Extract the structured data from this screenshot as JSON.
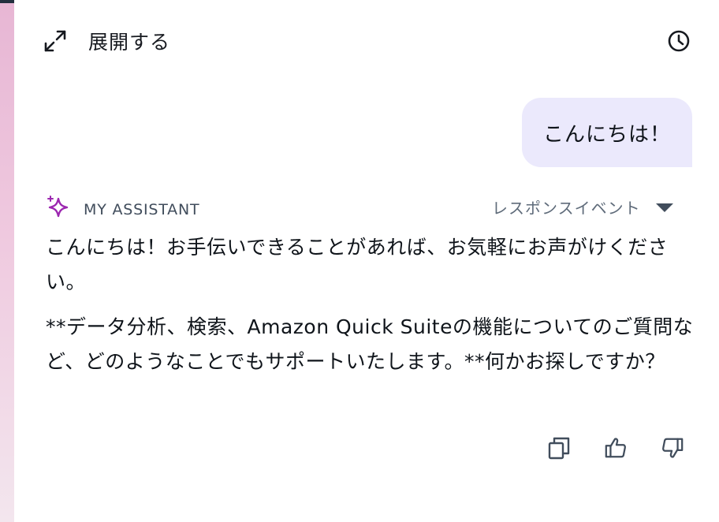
{
  "header": {
    "expand_label": "展開する",
    "expand_icon": "expand-arrows-icon",
    "history_icon": "clock-icon"
  },
  "conversation": {
    "user_message": "こんにちは！",
    "assistant": {
      "name": "MY ASSISTANT",
      "icon": "sparkle-icon",
      "response_events_label": "レスポンスイベント",
      "paragraphs": [
        "こんにちは！お手伝いできることがあれば、お気軽にお声がけください。",
        "**データ分析、検索、Amazon Quick Suiteの機能についてのご質問など、どのようなことでもサポートいたします。**何かお探しですか？"
      ]
    },
    "actions": {
      "copy_icon": "copy-icon",
      "like_icon": "thumbs-up-icon",
      "dislike_icon": "thumbs-down-icon"
    }
  },
  "colors": {
    "user_bubble": "#ebe9fc",
    "sparkle": "#9c27b0",
    "top_bar": "#232f3e",
    "left_strip": "#e7b6d4"
  }
}
